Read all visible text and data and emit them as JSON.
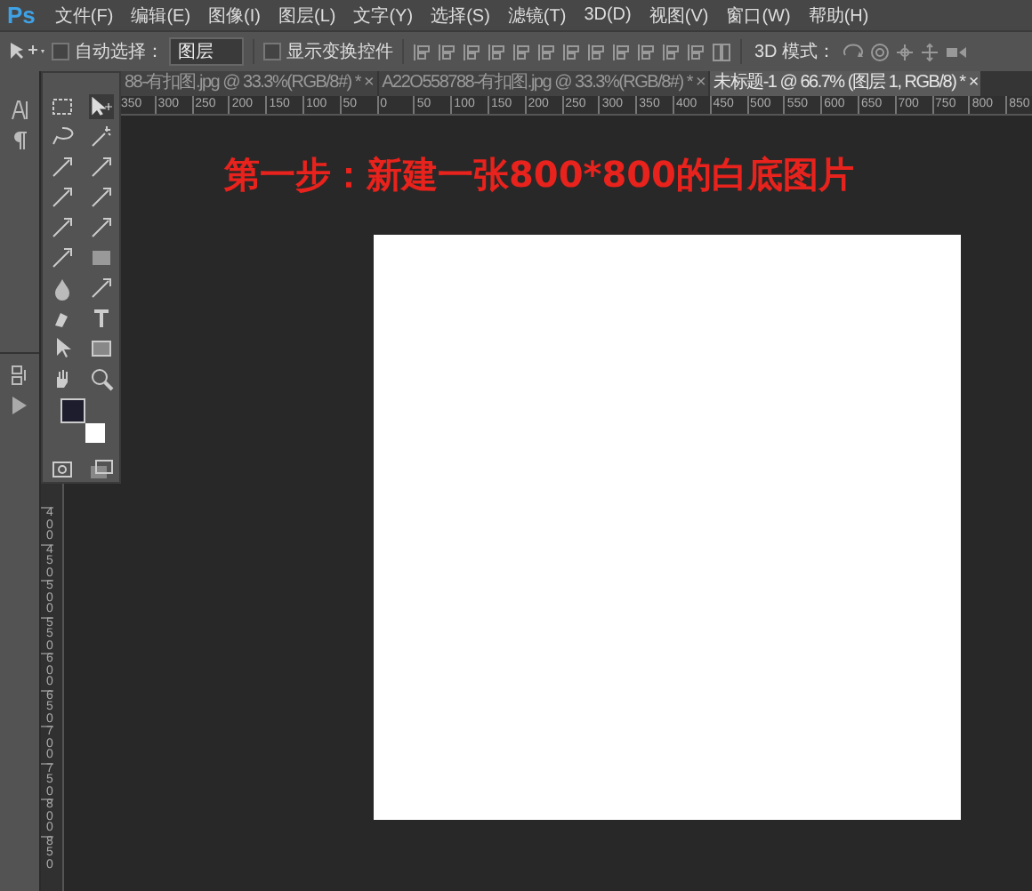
{
  "menu_bar": {
    "logo": "Ps",
    "items": [
      "文件(F)",
      "编辑(E)",
      "图像(I)",
      "图层(L)",
      "文字(Y)",
      "选择(S)",
      "滤镜(T)",
      "3D(D)",
      "视图(V)",
      "窗口(W)",
      "帮助(H)"
    ]
  },
  "options_bar": {
    "auto_select": {
      "label": "自动选择：",
      "checked": false
    },
    "target": "图层",
    "show_transform": {
      "label": "显示变换控件",
      "checked": false
    },
    "mode_label": "3D 模式："
  },
  "tabs": [
    {
      "label": "88-有扣图.jpg @ 33.3%(RGB/8#) *",
      "close": "×",
      "selected": false
    },
    {
      "label": "A22O558788-有扣图.jpg @ 33.3%(RGB/8#) *",
      "close": "×",
      "selected": false
    },
    {
      "label": "未标题-1 @ 66.7% (图层 1, RGB/8) *",
      "close": "×",
      "selected": true
    }
  ],
  "horizontal_ruler": [
    "350",
    "300",
    "250",
    "200",
    "150",
    "100",
    "50",
    "0",
    "50",
    "100",
    "150",
    "200",
    "250",
    "300",
    "350",
    "400",
    "450",
    "500",
    "550",
    "600",
    "650",
    "700",
    "750",
    "800",
    "850"
  ],
  "vertical_ruler": [
    "400",
    "450",
    "500",
    "550",
    "600",
    "650",
    "700",
    "750",
    "800",
    "850"
  ],
  "heading": "第一步：新建一张800*800的白底图片"
}
